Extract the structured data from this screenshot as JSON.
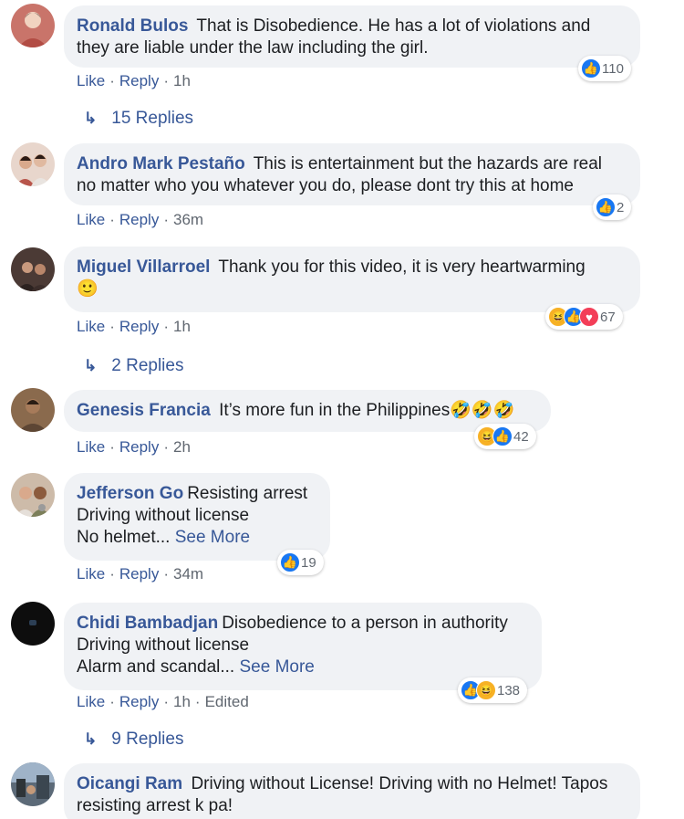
{
  "comments": [
    {
      "author": "Ronald Bulos",
      "text": "That is Disobedience. He has a lot of violations and they are liable under the law including the girl.",
      "like": "Like",
      "reply": "Reply",
      "time": "1h",
      "reaction_count": "110",
      "replies_label": "15 Replies",
      "avatar_color": "#c9746a"
    },
    {
      "author": "Andro Mark Pestaño",
      "text": "This is entertainment but the hazards are real no matter who you whatever you do, please dont try this at home",
      "like": "Like",
      "reply": "Reply",
      "time": "36m",
      "reaction_count": "2",
      "avatar_color": "#d9b7a8"
    },
    {
      "author": "Miguel Villarroel",
      "text": "Thank you for this video, it is very heartwarming",
      "emoji": "🙂",
      "like": "Like",
      "reply": "Reply",
      "time": "1h",
      "reaction_count": "67",
      "replies_label": "2 Replies",
      "avatar_color": "#4b3a35"
    },
    {
      "author": "Genesis Francia",
      "text": "It’s more fun in the Philippines🤣🤣🤣",
      "like": "Like",
      "reply": "Reply",
      "time": "2h",
      "reaction_count": "42",
      "avatar_color": "#8a6a4d"
    },
    {
      "author": "Jefferson Go",
      "text_lines": [
        "Resisting arrest",
        "Driving without license",
        "No helmet..."
      ],
      "see_more": "See More",
      "like": "Like",
      "reply": "Reply",
      "time": "34m",
      "reaction_count": "19",
      "avatar_color": "#b9a38f"
    },
    {
      "author": "Chidi Bambadjan",
      "text_lines": [
        "Disobedience to a person in authority",
        "Driving without license",
        "Alarm and scandal..."
      ],
      "see_more": "See More",
      "like": "Like",
      "reply": "Reply",
      "time": "1h",
      "edited": "Edited",
      "reaction_count": "138",
      "replies_label": "9 Replies",
      "avatar_color": "#0d0d0d"
    },
    {
      "author": "Oicangi Ram",
      "text": "Driving without License! Driving with no Helmet! Tapos resisting arrest k pa!",
      "avatar_color": "#5c6a78"
    }
  ],
  "colors": {
    "link": "#385898",
    "bubble": "#f0f2f5",
    "meta": "#606770",
    "like_blue": "#1877f2",
    "haha_yellow": "#f7b125",
    "love_red": "#f33e58"
  }
}
